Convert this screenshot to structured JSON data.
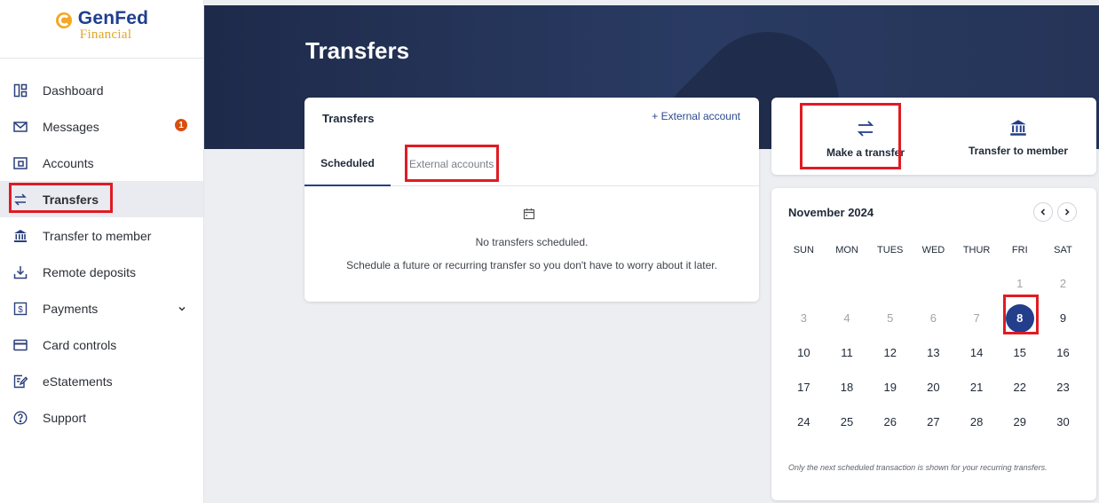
{
  "brand": {
    "name": "GenFed",
    "subtitle": "Financial"
  },
  "sidebar": {
    "items": [
      {
        "label": "Dashboard"
      },
      {
        "label": "Messages",
        "badge": "1"
      },
      {
        "label": "Accounts"
      },
      {
        "label": "Transfers",
        "active": true
      },
      {
        "label": "Transfer to member"
      },
      {
        "label": "Remote deposits"
      },
      {
        "label": "Payments"
      },
      {
        "label": "Card controls"
      },
      {
        "label": "eStatements"
      },
      {
        "label": "Support"
      }
    ]
  },
  "page": {
    "title": "Transfers"
  },
  "transfers_card": {
    "title": "Transfers",
    "external_link": "+ External account",
    "tabs": [
      {
        "label": "Scheduled",
        "selected": true
      },
      {
        "label": "External accounts"
      }
    ],
    "empty_title": "No transfers scheduled.",
    "empty_message": "Schedule a future or recurring transfer so you don't have to worry about it later."
  },
  "actions": {
    "make_transfer": "Make a transfer",
    "transfer_to_member": "Transfer to member"
  },
  "calendar": {
    "month": "November 2024",
    "weekdays": [
      "SUN",
      "MON",
      "TUES",
      "WED",
      "THUR",
      "FRI",
      "SAT"
    ],
    "weeks": [
      [
        "",
        "",
        "",
        "",
        "",
        "1",
        "2"
      ],
      [
        "3",
        "4",
        "5",
        "6",
        "7",
        "8",
        "9"
      ],
      [
        "10",
        "11",
        "12",
        "13",
        "14",
        "15",
        "16"
      ],
      [
        "17",
        "18",
        "19",
        "20",
        "21",
        "22",
        "23"
      ],
      [
        "24",
        "25",
        "26",
        "27",
        "28",
        "29",
        "30"
      ]
    ],
    "selected_day": "8",
    "note": "Only the next scheduled transaction is shown for your recurring transfers."
  },
  "colors": {
    "primary": "#233e8a",
    "hero": "#1e2a4a",
    "highlight": "#e01b24",
    "badge": "#d94f10",
    "logo_gold": "#e2a526"
  },
  "icons": {
    "dashboard": "dashboard-icon",
    "messages": "mail-icon",
    "accounts": "accounts-icon",
    "transfers": "transfer-arrows-icon",
    "member": "bank-icon",
    "deposits": "download-tray-icon",
    "payments": "dollar-icon",
    "card": "credit-card-icon",
    "estatements": "edit-document-icon",
    "support": "help-circle-icon",
    "calendar": "calendar-icon"
  }
}
